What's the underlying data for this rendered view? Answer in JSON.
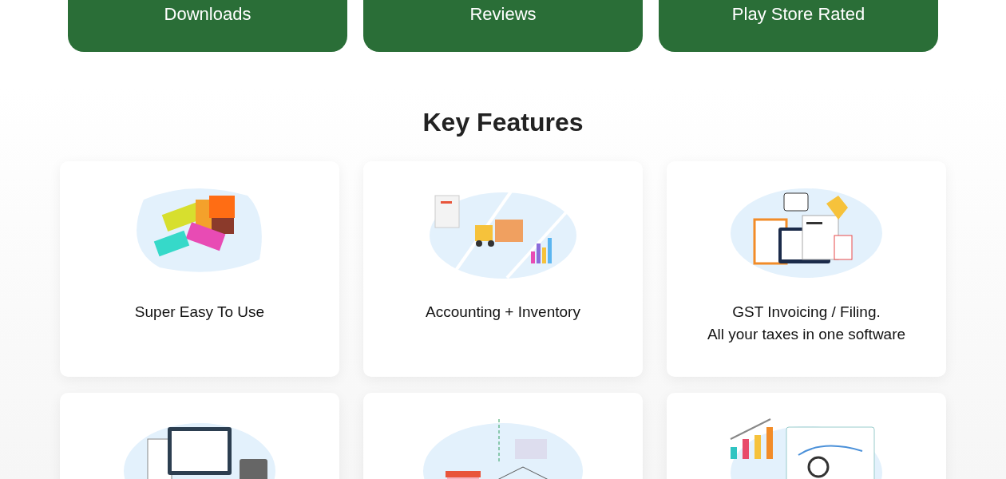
{
  "stats": [
    {
      "label": "Downloads"
    },
    {
      "label": "Reviews"
    },
    {
      "label": "Play Store Rated"
    }
  ],
  "heading": "Key Features",
  "features": [
    {
      "kind": "blocks",
      "title": "Super Easy To Use"
    },
    {
      "kind": "warehouse",
      "title": "Accounting + Inventory"
    },
    {
      "kind": "tax",
      "title": "GST Invoicing / Filing.\nAll your taxes in one software"
    },
    {
      "kind": "invoice"
    },
    {
      "kind": "store"
    },
    {
      "kind": "analytics"
    }
  ]
}
